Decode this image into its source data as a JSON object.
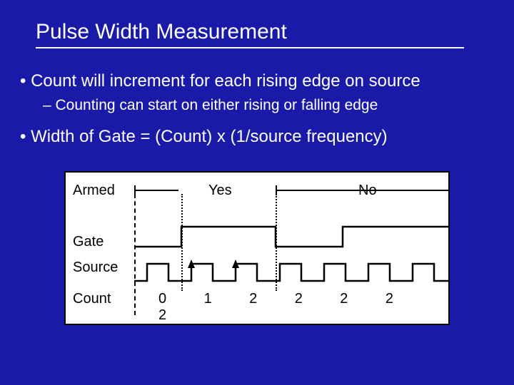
{
  "title": "Pulse Width Measurement",
  "bullets": {
    "b1": "Count will increment for each rising edge on source",
    "b1sub": "Counting can start on either rising or falling edge",
    "b2": "Width of Gate = (Count) x (1/source frequency)"
  },
  "diagram": {
    "labels": {
      "armed": "Armed",
      "gate": "Gate",
      "source": "Source",
      "count": "Count"
    },
    "armed_yes": "Yes",
    "armed_no": "No",
    "counts": [
      "0",
      "1",
      "2",
      "2",
      "2",
      "2",
      "2"
    ]
  }
}
